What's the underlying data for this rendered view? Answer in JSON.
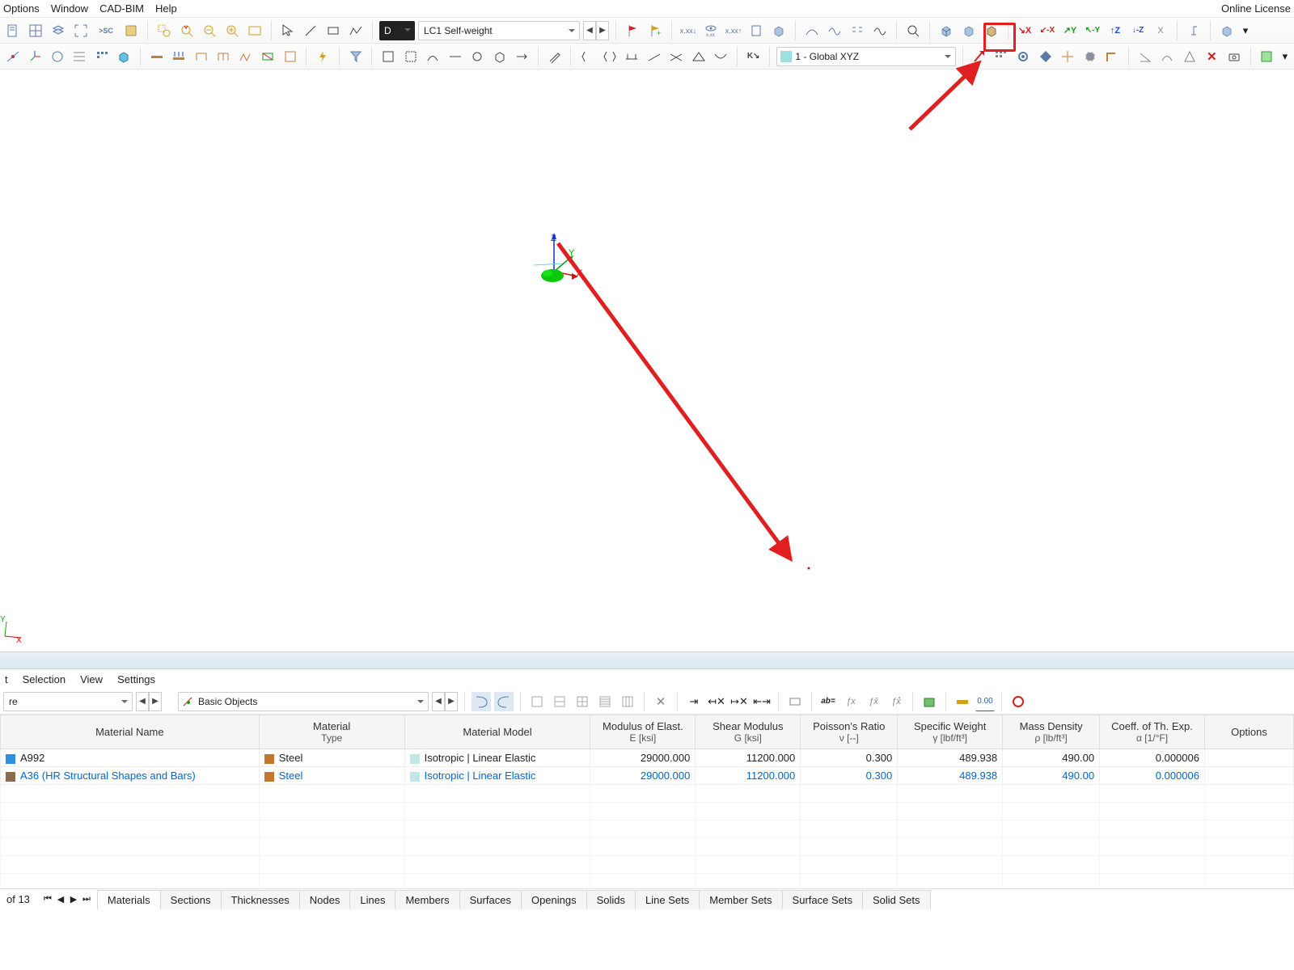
{
  "license_text": "Online License",
  "menubar": [
    "Options",
    "Window",
    "CAD-BIM",
    "Help"
  ],
  "loadcase_box": "D",
  "loadcase_dropdown": "LC1    Self-weight",
  "coord_dropdown": "1 - Global XYZ",
  "axis_labels": {
    "x": "X",
    "y": "Y",
    "z": "Z"
  },
  "bottom_menu": [
    "t",
    "Selection",
    "View",
    "Settings"
  ],
  "nav_dropdown_left": "re",
  "nav_dropdown_right": "Basic Objects",
  "record_text": "of 13",
  "table": {
    "headers": [
      {
        "h": "Material Name",
        "u": ""
      },
      {
        "h": "Material",
        "u": "Type"
      },
      {
        "h": "Material Model",
        "u": ""
      },
      {
        "h": "Modulus of Elast.",
        "u": "E [ksi]"
      },
      {
        "h": "Shear Modulus",
        "u": "G [ksi]"
      },
      {
        "h": "Poisson's Ratio",
        "u": "ν [--]"
      },
      {
        "h": "Specific Weight",
        "u": "γ [lbf/ft³]"
      },
      {
        "h": "Mass Density",
        "u": "ρ [lb/ft³]"
      },
      {
        "h": "Coeff. of Th. Exp.",
        "u": "α [1/°F]"
      },
      {
        "h": "Options",
        "u": ""
      }
    ],
    "rows": [
      {
        "swatch": "#2d8fe0",
        "name": "A992",
        "type_swatch": "#c4762c",
        "type": "Steel",
        "model_swatch": "#bfe7e7",
        "model": "Isotropic | Linear Elastic",
        "e": "29000.000",
        "g": "11200.000",
        "v": "0.300",
        "sw": "489.938",
        "md": "490.00",
        "cte": "0.000006",
        "opts": ""
      },
      {
        "swatch": "#8a6b4b",
        "name": "A36 (HR Structural Shapes and Bars)",
        "type_swatch": "#c4762c",
        "type": "Steel",
        "model_swatch": "#bfe7e7",
        "model": "Isotropic | Linear Elastic",
        "e": "29000.000",
        "g": "11200.000",
        "v": "0.300",
        "sw": "489.938",
        "md": "490.00",
        "cte": "0.000006",
        "opts": "",
        "selected": true
      }
    ]
  },
  "tabs": [
    "Materials",
    "Sections",
    "Thicknesses",
    "Nodes",
    "Lines",
    "Members",
    "Surfaces",
    "Openings",
    "Solids",
    "Line Sets",
    "Member Sets",
    "Surface Sets",
    "Solid Sets"
  ],
  "active_tab": "Materials"
}
